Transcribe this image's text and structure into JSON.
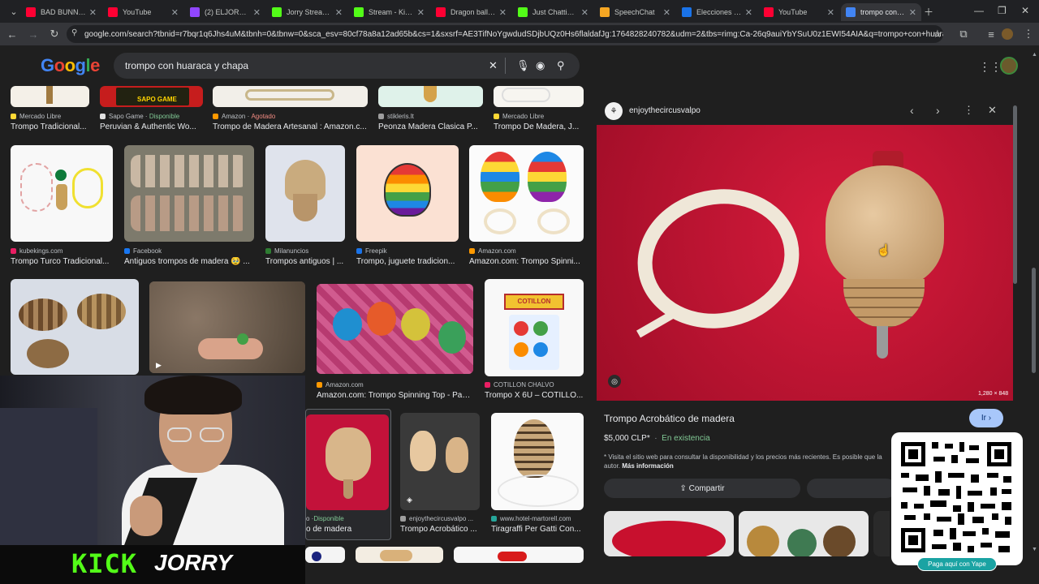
{
  "browser": {
    "tabs": [
      {
        "label": "BAD BUNNY x",
        "color": "#ff0033"
      },
      {
        "label": "YouTube",
        "color": "#ff0033"
      },
      {
        "label": "(2) ELJORRY - T",
        "color": "#9146ff"
      },
      {
        "label": "Jorry Stream -",
        "color": "#53fc18"
      },
      {
        "label": "Stream - Kick D",
        "color": "#53fc18"
      },
      {
        "label": "Dragon ball z e",
        "color": "#ff0033"
      },
      {
        "label": "Just Chatting S",
        "color": "#53fc18"
      },
      {
        "label": "SpeechChat",
        "color": "#f5a623"
      },
      {
        "label": "Elecciones 202",
        "color": "#1a73e8"
      },
      {
        "label": "YouTube",
        "color": "#ff0033"
      },
      {
        "label": "trompo con hu",
        "color": "#4285f4"
      }
    ],
    "url": "google.com/search?tbnid=r7bqr1q6Jhs4uM&tbnh=0&tbnw=0&sca_esv=80cf78a8a12ad65b&cs=1&sxsrf=AE3TifNoYgwdudSDjbUQz0Hs6flaldafJg:1764828240782&udm=2&tbs=rimg:Ca-26q9auiYbYSuU0z1EWI54AIA&q=trompo+con+huaraca+y+c..."
  },
  "google": {
    "logo_text": "Google",
    "query": "trompo con huaraca y chapa"
  },
  "results_row1": [
    {
      "source": "Mercado Libre",
      "title": "Trompo Tradicional...",
      "color": "#fdd835"
    },
    {
      "source": "Sapo Game",
      "status": "Disponible",
      "title": "Peruvian & Authentic Wo...",
      "color": "#e0e0e0"
    },
    {
      "source": "Amazon",
      "status": "Agotado",
      "title": "Trompo de Madera Artesanal : Amazon.c...",
      "color": "#ff9900"
    },
    {
      "source": "stikleris.lt",
      "title": "Peonza Madera Clasica P...",
      "color": "#9e9e9e"
    },
    {
      "source": "Mercado Libre",
      "title": "Trompo De Madera, J...",
      "color": "#fdd835"
    }
  ],
  "results_row2": [
    {
      "source": "kubekings.com",
      "title": "Trompo Turco Tradicional...",
      "color": "#e91e63"
    },
    {
      "source": "Facebook",
      "title": "Antiguos trompos de madera 🥹 ...",
      "color": "#1877f2"
    },
    {
      "source": "Milanuncios",
      "title": "Trompos antiguos | ...",
      "color": "#2e7d32"
    },
    {
      "source": "Freepik",
      "title": "Trompo, juguete tradicion...",
      "color": "#1a73e8"
    },
    {
      "source": "Amazon.com",
      "title": "Amazon.com: Trompo Spinni...",
      "color": "#ff9900"
    }
  ],
  "results_row3": [
    {
      "source": "Amazon.com",
      "title": "Amazon.com: Trompo Spinning Top - Paq...",
      "color": "#ff9900"
    },
    {
      "source": "COTILLON CHALVO",
      "title": "Trompo X 6U – COTILLO...",
      "color": "#e91e63"
    }
  ],
  "results_row4": [
    {
      "source": "o · ",
      "status": "Disponible",
      "title": "o de madera",
      "color": "#1f1f1f"
    },
    {
      "source": "enjoythecircusvalpo ...",
      "title": "Trompo Acrobático ...",
      "color": "#9e9e9e"
    },
    {
      "source": "www.hotel-martorell.com",
      "title": "Tiragraffi Per Gatti Con...",
      "color": "#26a69a"
    }
  ],
  "preview": {
    "site": "enjoythecircusvalpo",
    "dimensions": "1,280 × 848",
    "title": "Trompo Acrobático de madera",
    "price": "$5,000 CLP*",
    "stock": "En existencia",
    "note": "* Visita el sitio web para consultar la disponibilidad y los precios más recientes. Es posible que la",
    "note2": "autor.",
    "more_info": "Más información",
    "visit_label": "Ir",
    "share_label": "Compartir"
  },
  "overlay": {
    "brand": "KICK",
    "channel": "JORRY",
    "qr_label": "Paga aquí con Yape"
  },
  "colors": {
    "accent_blue": "#a8c7fa",
    "kick_green": "#53fc18",
    "in_stock": "#81c995",
    "sold_out": "#f28b82"
  }
}
